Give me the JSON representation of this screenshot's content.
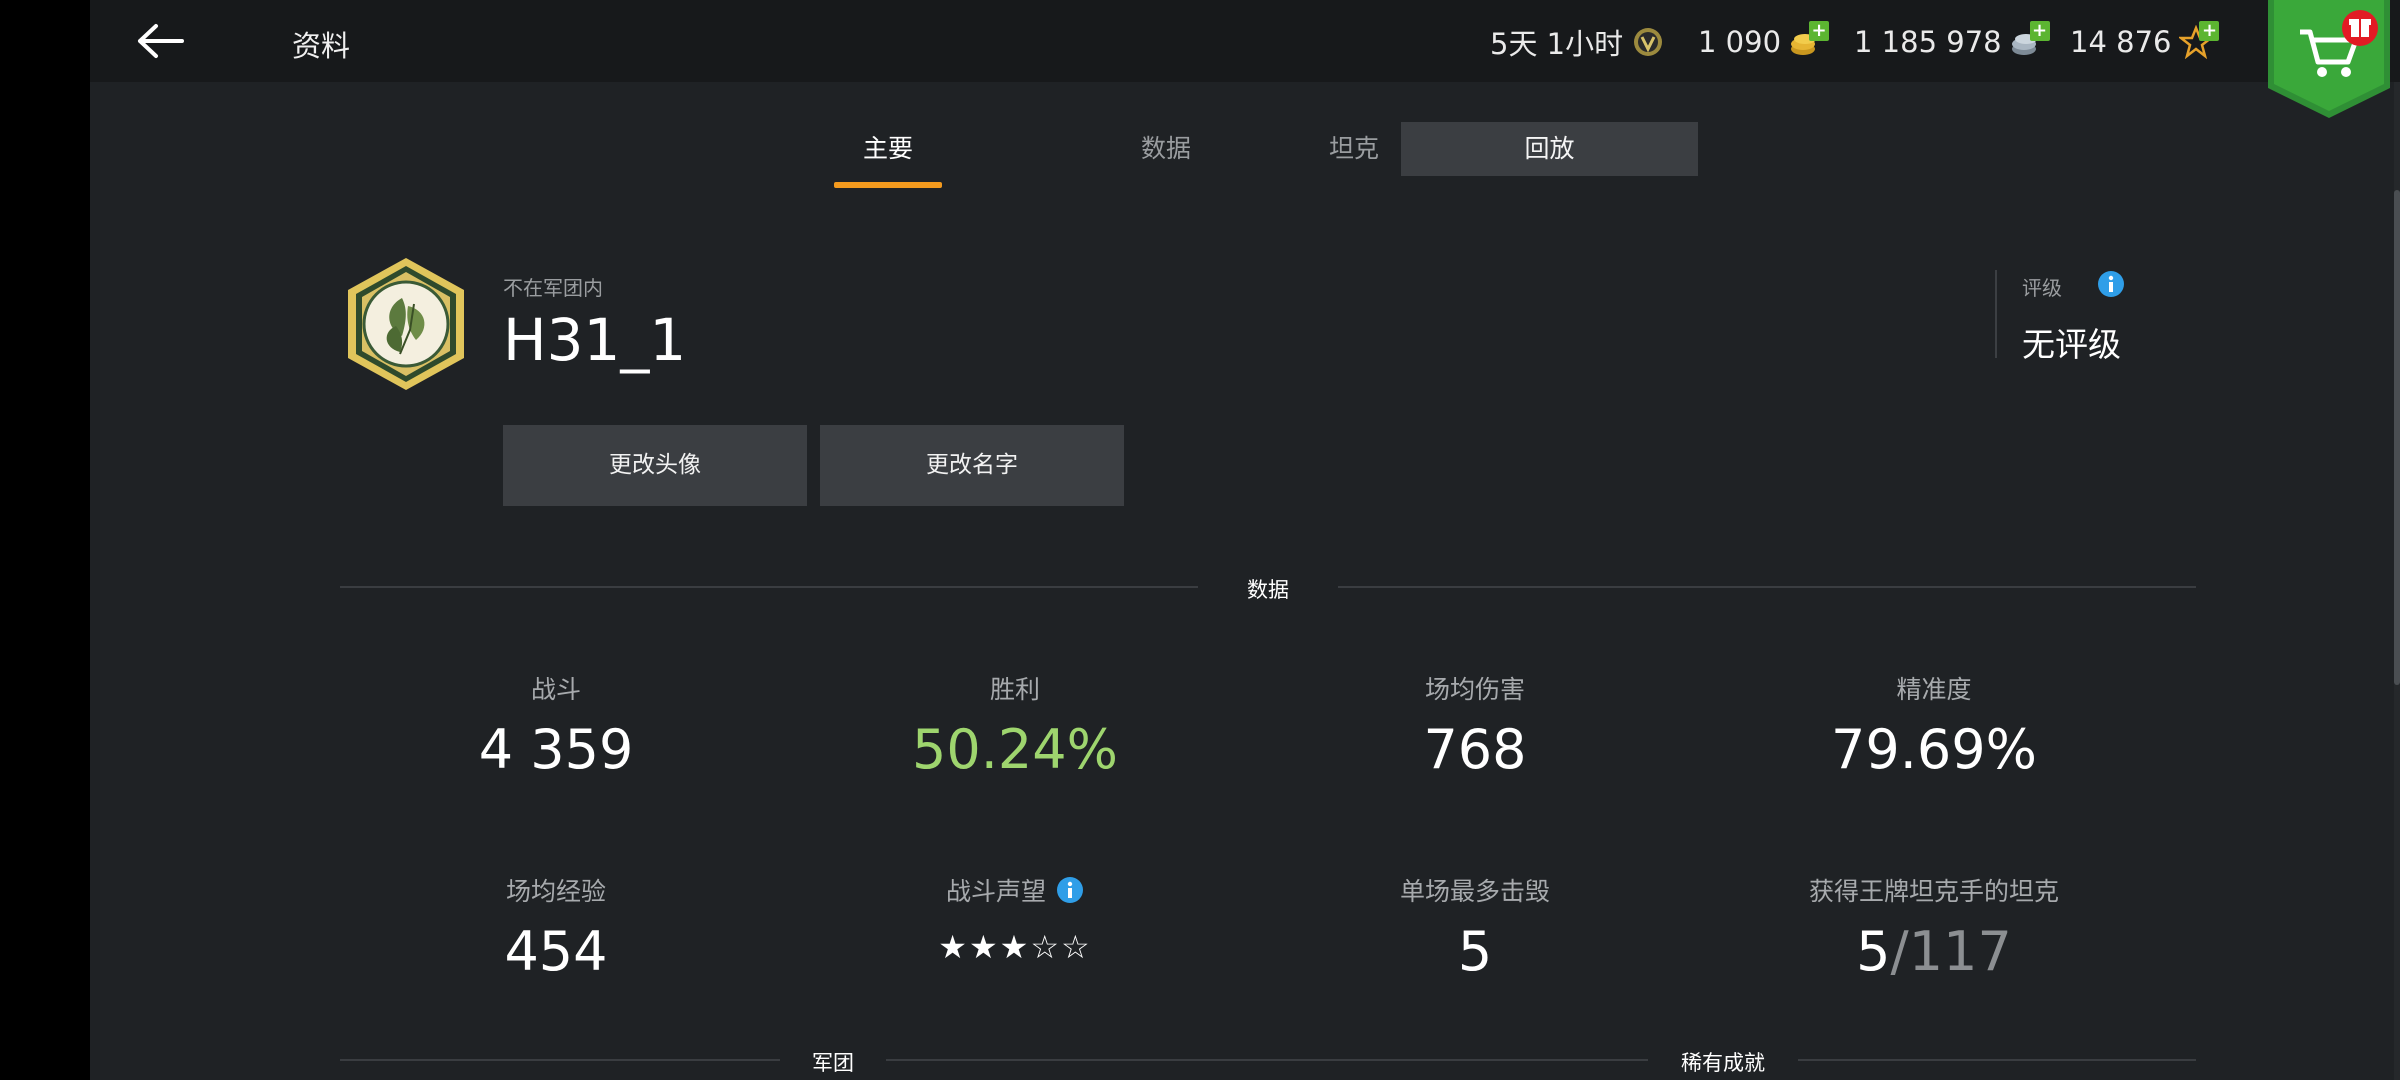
{
  "header": {
    "title": "资料",
    "premium_time": "5天 1小时",
    "gold": "1 090",
    "credits": "1 185 978",
    "free_xp": "14 876"
  },
  "tabs": [
    {
      "label": "主要",
      "active": true
    },
    {
      "label": "数据",
      "active": false
    },
    {
      "label": "坦克",
      "active": false
    },
    {
      "label": "回放",
      "active": false
    }
  ],
  "profile": {
    "clan_status": "不在军团内",
    "name": "H31_1",
    "change_avatar": "更改头像",
    "change_name": "更改名字",
    "rating_label": "评级",
    "rating_value": "无评级"
  },
  "sections": {
    "stats": "数据",
    "clan": "军团",
    "rare": "稀有成就"
  },
  "stats": {
    "battles_label": "战斗",
    "battles": "4 359",
    "wins_label": "胜利",
    "wins": "50.24%",
    "avg_damage_label": "场均伤害",
    "avg_damage": "768",
    "accuracy_label": "精准度",
    "accuracy": "79.69%",
    "avg_xp_label": "场均经验",
    "avg_xp": "454",
    "reputation_label": "战斗声望",
    "reputation_stars": 3,
    "reputation_max": 5,
    "max_kills_label": "单场最多击毁",
    "max_kills": "5",
    "mastery_label": "获得王牌坦克手的坦克",
    "mastery_count": "5",
    "mastery_separator": "/",
    "mastery_total": "117"
  },
  "colors": {
    "accent": "#f39a1e",
    "win_rate": "#9ed56e",
    "info": "#2f9ee8",
    "shop": "#3aa83a"
  }
}
